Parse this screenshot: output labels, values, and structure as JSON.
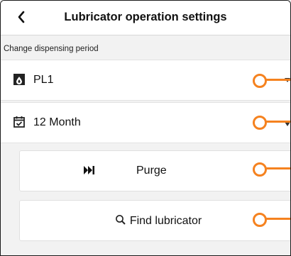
{
  "header": {
    "back_label": "<",
    "title": "Lubricator operation settings"
  },
  "section": {
    "label": "Change dispensing period"
  },
  "rows": [
    {
      "label": "PL1",
      "icon": "lubricator-icon"
    },
    {
      "label": "12 Month",
      "icon": "calendar-check-icon"
    }
  ],
  "buttons": [
    {
      "label": "Purge",
      "icon": "skip-forward-icon"
    },
    {
      "label": "Find lubricator",
      "icon": "search-icon"
    }
  ],
  "colors": {
    "callout": "#f5821f",
    "background": "#f2f2f2",
    "surface": "#ffffff"
  }
}
